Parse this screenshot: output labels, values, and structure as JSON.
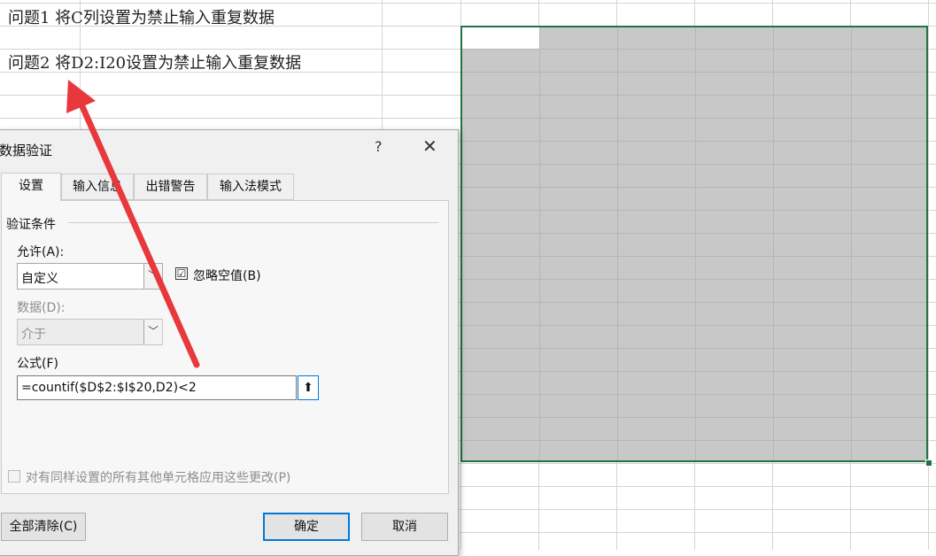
{
  "sheet": {
    "question1": "问题1 将C列设置为禁止输入重复数据",
    "question2": "问题2 将D2:I20设置为禁止输入重复数据"
  },
  "dialog": {
    "title": "数据验证",
    "help_label": "?",
    "close_label": "✕",
    "tabs": [
      {
        "label": "设置"
      },
      {
        "label": "输入信息"
      },
      {
        "label": "出错警告"
      },
      {
        "label": "输入法模式"
      }
    ],
    "group_label": "验证条件",
    "allow_label": "允许(A):",
    "allow_value": "自定义",
    "ignore_blank_label": "忽略空值(B)",
    "ignore_blank_checked": "☑",
    "data_label": "数据(D):",
    "data_value": "介于",
    "formula_label": "公式(F)",
    "formula_value": "=countif($D$2:$I$20,D2)<2",
    "collapse_icon": "⬆",
    "apply_all_label": "对有同样设置的所有其他单元格应用这些更改(P)",
    "clear_all_label": "全部清除(C)",
    "ok_label": "确定",
    "cancel_label": "取消"
  },
  "annotation": {
    "arrow_color": "#e8383d"
  }
}
